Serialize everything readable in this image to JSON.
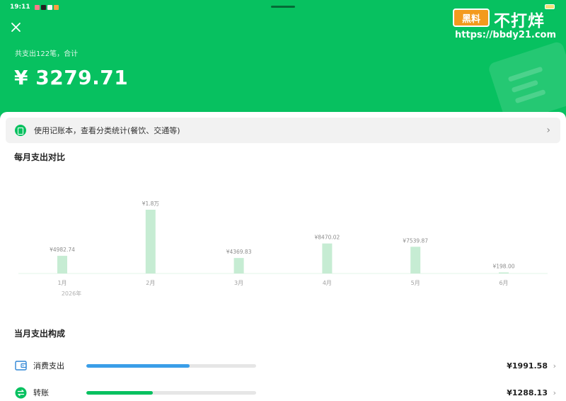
{
  "status_bar": {
    "time": "19:11"
  },
  "watermark": {
    "logo_text": "黑料",
    "title": "不打烊",
    "url": "https://bbdy21.com"
  },
  "header": {
    "summary_caption": "共支出122笔，合计",
    "total_amount": "¥ 3279.71",
    "brand_color": "#07c160"
  },
  "banner": {
    "text": "使用记账本，查看分类统计(餐饮、交通等)",
    "chevron": "›"
  },
  "monthly_section": {
    "title": "每月支出对比"
  },
  "chart_data": {
    "type": "bar",
    "categories": [
      "1月",
      "2月",
      "3月",
      "4月",
      "5月",
      "6月"
    ],
    "values": [
      4982.74,
      18000,
      4369.83,
      8470.02,
      7539.87,
      198.0
    ],
    "value_labels": [
      "¥4982.74",
      "¥1.8万",
      "¥4369.83",
      "¥8470.02",
      "¥7539.87",
      "¥198.00"
    ],
    "year_label": "2026年",
    "bar_color": "#c6ecd3",
    "label_color": "#8c8c8c"
  },
  "composition_section": {
    "title": "当月支出构成"
  },
  "breakdown": [
    {
      "icon": "wallet-icon",
      "label": "消费支出",
      "amount": "¥1991.58",
      "fraction": 0.607,
      "color": "#3a9ee8",
      "chevron": "›"
    },
    {
      "icon": "transfer-icon",
      "label": "转账",
      "amount": "¥1288.13",
      "fraction": 0.393,
      "color": "#07c160",
      "chevron": "›"
    }
  ]
}
